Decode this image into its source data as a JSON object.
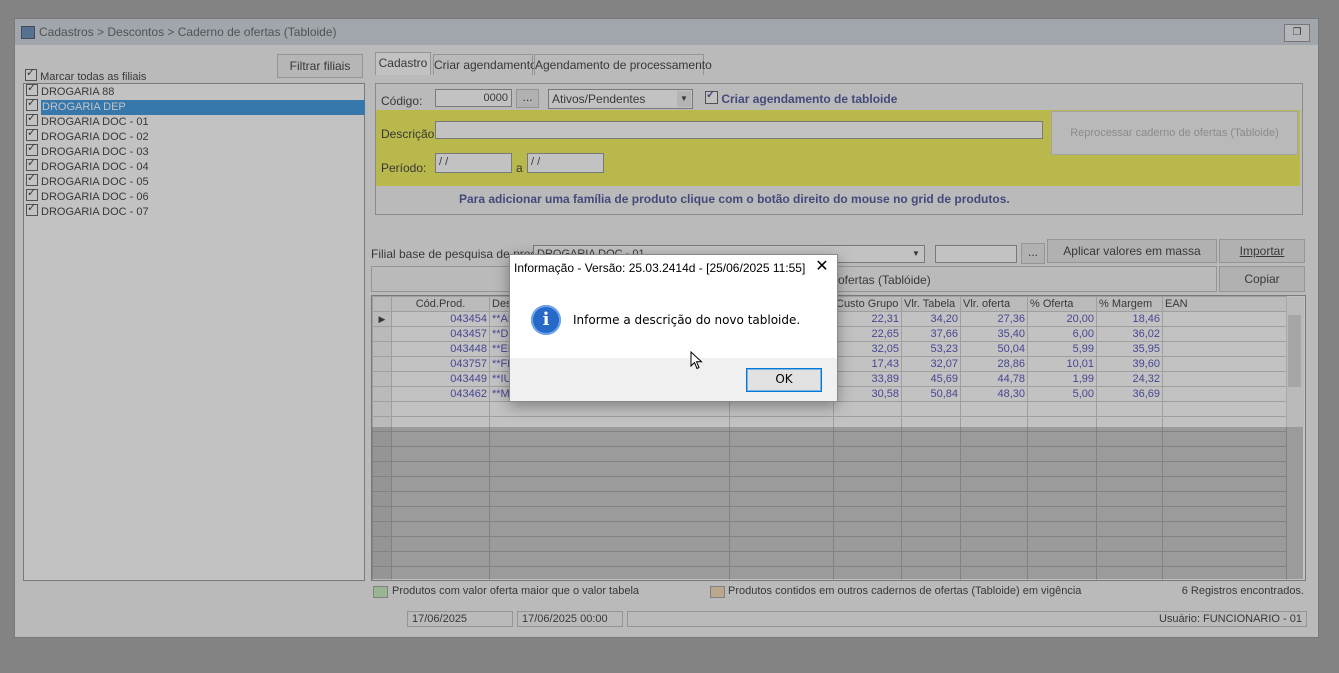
{
  "window": {
    "title": "Cadastros > Descontos > Caderno de ofertas (Tabloide)",
    "restore_icon": "restore-icon"
  },
  "left_panel": {
    "filter_button": "Filtrar filiais",
    "mark_all": "Marcar todas as filiais",
    "branches": [
      {
        "label": "DROGARIA 88",
        "checked": true,
        "selected": false
      },
      {
        "label": "DROGARIA DEP",
        "checked": true,
        "selected": true
      },
      {
        "label": "DROGARIA DOC - 01",
        "checked": true,
        "selected": false
      },
      {
        "label": "DROGARIA DOC - 02",
        "checked": true,
        "selected": false
      },
      {
        "label": "DROGARIA DOC - 03",
        "checked": true,
        "selected": false
      },
      {
        "label": "DROGARIA DOC - 04",
        "checked": true,
        "selected": false
      },
      {
        "label": "DROGARIA DOC - 05",
        "checked": true,
        "selected": false
      },
      {
        "label": "DROGARIA DOC - 06",
        "checked": true,
        "selected": false
      },
      {
        "label": "DROGARIA DOC - 07",
        "checked": true,
        "selected": false
      }
    ]
  },
  "tabs": [
    {
      "label": "Cadastro",
      "active": true
    },
    {
      "label": "Criar agendamento",
      "active": false
    },
    {
      "label": "Agendamento de processamento",
      "active": false
    }
  ],
  "form": {
    "codigo_label": "Código:",
    "codigo_value": "0000",
    "lookup_button": "...",
    "status_select": "Ativos/Pendentes",
    "criar_agendamento_label": "Criar agendamento de tabloide",
    "criar_agendamento_checked": true,
    "descricao_label": "Descrição:",
    "descricao_value": "",
    "periodo_label": "Período:",
    "periodo_start": "/ /",
    "periodo_sep": "a",
    "periodo_end": "/ /",
    "reprocess_button": "Reprocessar caderno de ofertas (Tabloide)",
    "hint": "Para adicionar uma família de produto clique com o botão direito do  mouse no grid de produtos."
  },
  "filial_base": {
    "label": "Filial base de pesquisa de preço",
    "value": "DROGARIA DOC - 01",
    "search_value": "",
    "lookup_button": "...",
    "apply_button": "Aplicar valores em massa",
    "import_button": "Importar",
    "copy_button": "Copiar",
    "bar_text": "ofertas (Tablóide)"
  },
  "grid": {
    "columns": [
      "Cód.Prod.",
      "Des",
      "",
      "Custo Grupo",
      "Vlr. Tabela",
      "Vlr. oferta",
      "% Oferta",
      "% Margem",
      "EAN"
    ],
    "rows": [
      {
        "cod": "043454",
        "desc": "**AL",
        "custo": "22,31",
        "tabela": "34,20",
        "oferta": "27,36",
        "pct_oferta": "20,00",
        "margem": "18,46",
        "ean": "",
        "current": true
      },
      {
        "cod": "043457",
        "desc": "**DI",
        "custo": "22,65",
        "tabela": "37,66",
        "oferta": "35,40",
        "pct_oferta": "6,00",
        "margem": "36,02",
        "ean": "",
        "current": false
      },
      {
        "cod": "043448",
        "desc": "**EL",
        "custo": "32,05",
        "tabela": "53,23",
        "oferta": "50,04",
        "pct_oferta": "5,99",
        "margem": "35,95",
        "ean": "",
        "current": false
      },
      {
        "cod": "043757",
        "desc": "**FE",
        "custo": "17,43",
        "tabela": "32,07",
        "oferta": "28,86",
        "pct_oferta": "10,01",
        "margem": "39,60",
        "ean": "",
        "current": false
      },
      {
        "cod": "043449",
        "desc": "**IU",
        "custo": "33,89",
        "tabela": "45,69",
        "oferta": "44,78",
        "pct_oferta": "1,99",
        "margem": "24,32",
        "ean": "",
        "current": false
      },
      {
        "cod": "043462",
        "desc": "**MI",
        "custo": "30,58",
        "tabela": "50,84",
        "oferta": "48,30",
        "pct_oferta": "5,00",
        "margem": "36,69",
        "ean": "",
        "current": false
      }
    ]
  },
  "legend": {
    "green_text": "Produtos com valor oferta maior que o valor tabela",
    "green_color": "#b9e5a8",
    "orange_text": "Produtos contidos em outros cadernos de ofertas (Tabloide) em vigência",
    "orange_color": "#f6cfa2",
    "records": "6 Registros encontrados."
  },
  "status": {
    "date": "17/06/2025",
    "datetime": "17/06/2025 00:00",
    "user": "Usuário: FUNCIONARIO - 01"
  },
  "dialog": {
    "title": "Informação - Versão: 25.03.2414d - [25/06/2025 11:55]",
    "close_icon": "close-icon",
    "icon": "info-icon",
    "message": "Informe a descrição do novo tabloide.",
    "ok_button": "OK"
  }
}
